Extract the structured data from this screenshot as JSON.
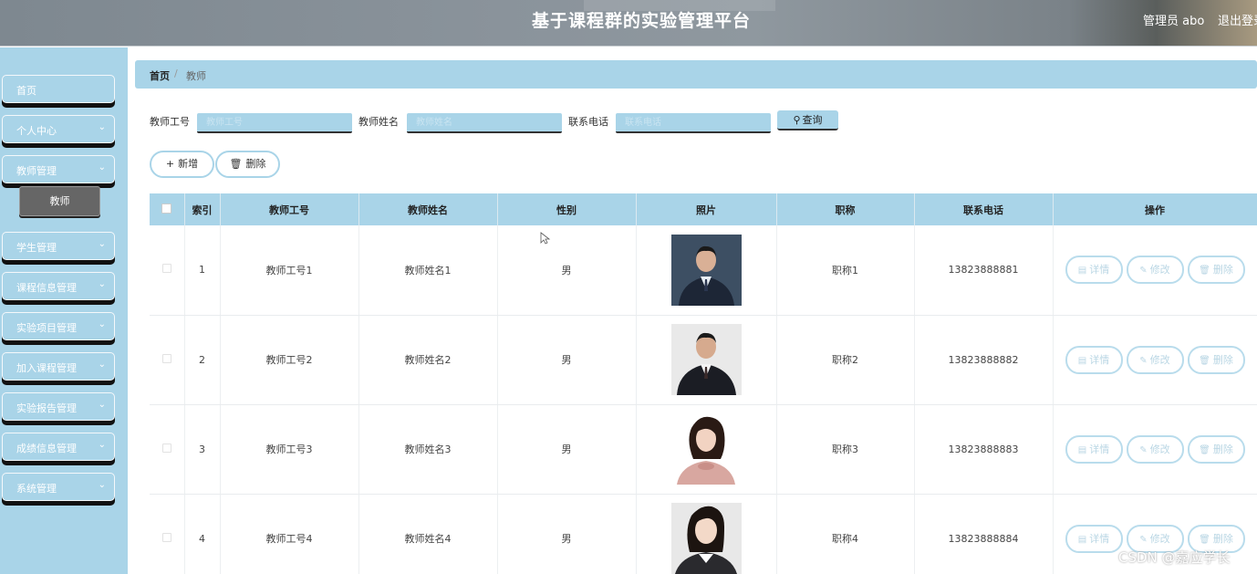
{
  "header": {
    "title": "基于课程群的实验管理平台",
    "user": "管理员 abo",
    "logout": "退出登录"
  },
  "sidebar": {
    "items": [
      {
        "label": "首页",
        "has_chevron": false
      },
      {
        "label": "个人中心",
        "has_chevron": true
      },
      {
        "label": "教师管理",
        "has_chevron": true
      },
      {
        "label": "学生管理",
        "has_chevron": true
      },
      {
        "label": "课程信息管理",
        "has_chevron": true
      },
      {
        "label": "实验项目管理",
        "has_chevron": true
      },
      {
        "label": "加入课程管理",
        "has_chevron": true
      },
      {
        "label": "实验报告管理",
        "has_chevron": true
      },
      {
        "label": "成绩信息管理",
        "has_chevron": true
      },
      {
        "label": "系统管理",
        "has_chevron": true
      }
    ],
    "sub_item": "教师"
  },
  "breadcrumb": {
    "home": "首页",
    "separator": "/",
    "current": "教师"
  },
  "search": {
    "teacher_no_label": "教师工号",
    "teacher_no_placeholder": "教师工号",
    "teacher_name_label": "教师姓名",
    "teacher_name_placeholder": "教师姓名",
    "phone_label": "联系电话",
    "phone_placeholder": "联系电话",
    "query_label": "查询"
  },
  "actions": {
    "add_label": "新增",
    "delete_label": "删除"
  },
  "table": {
    "headers": [
      "索引",
      "教师工号",
      "教师姓名",
      "性别",
      "照片",
      "职称",
      "联系电话",
      "操作"
    ],
    "rows": [
      {
        "index": "1",
        "teacher_no": "教师工号1",
        "name": "教师姓名1",
        "gender": "男",
        "title": "职称1",
        "phone": "13823888881"
      },
      {
        "index": "2",
        "teacher_no": "教师工号2",
        "name": "教师姓名2",
        "gender": "男",
        "title": "职称2",
        "phone": "13823888882"
      },
      {
        "index": "3",
        "teacher_no": "教师工号3",
        "name": "教师姓名3",
        "gender": "男",
        "title": "职称3",
        "phone": "13823888883"
      },
      {
        "index": "4",
        "teacher_no": "教师工号4",
        "name": "教师姓名4",
        "gender": "男",
        "title": "职称4",
        "phone": "13823888884"
      }
    ],
    "row_actions": {
      "detail": "详情",
      "edit": "修改",
      "delete": "删除"
    }
  },
  "watermark": "CSDN @嘉应学长",
  "colors": {
    "accent": "#a9d4e8",
    "sidebar": "#a9d4e8",
    "active_sub": "#666666",
    "header": "#8a939b"
  }
}
